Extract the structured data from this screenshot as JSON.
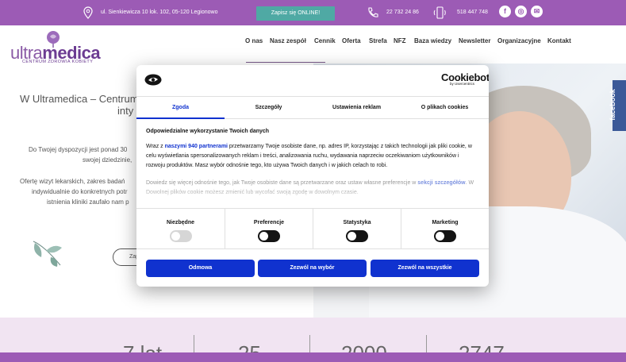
{
  "topbar": {
    "address": "ul. Sienkiewicza 10 lok. 102, 05-120 Legionowo",
    "online_button": "Zapisz się ONLINE!",
    "phone1": "22 732 24 86",
    "phone2": "518 447 748",
    "social": [
      "f",
      "◎",
      "✉"
    ]
  },
  "brand": {
    "logo_ultra": "ultra",
    "logo_medica": "medica",
    "logo_sub": "CENTRUM ZDROWIA KOBIETY"
  },
  "nav": [
    "O nas",
    "Nasz zespół",
    "Cennik",
    "Oferta",
    "Strefa",
    "NFZ",
    "Baza wiedzy",
    "Newsletter",
    "Organizacyjne",
    "Kontakt"
  ],
  "hero": {
    "title_line1": "W Ultramedica – Centrum",
    "title_line2": "inty",
    "p1_line1": "Do Twojej dyspozycji jest ponad 30",
    "p1_line2": "swojej dziedzinie,",
    "p2_line1": "Ofertę wizyt lekarskich, zakres badań",
    "p2_line2": "indywidualnie do konkretnych potr",
    "p2_line3": "istnienia kliniki zaufało nam p",
    "button": "Zap"
  },
  "facebook_tab": "facebook",
  "stats": [
    "7 lat",
    "25",
    "2000",
    "2747"
  ],
  "cookie_dialog": {
    "brand": "Cookiebot",
    "brand_sub": "by Usercentrics",
    "tabs": [
      "Zgoda",
      "Szczegóły",
      "Ustawienia reklam",
      "O plikach cookies"
    ],
    "active_tab": 0,
    "heading": "Odpowiedzialne wykorzystanie Twoich danych",
    "body_prefix": "Wraz z ",
    "partners_link": "naszymi 940 partnerami",
    "body_rest": " przetwarzamy Twoje osobiste dane, np. adres IP, korzystając z takich technologii jak pliki cookie, w celu wyświetlania spersonalizowanych reklam i treści, analizowania ruchu, wydawania naprzeciw oczekiwaniom użytkowników i rozwoju produktów. Masz wybór odnośnie tego, kto używa Twoich danych i w jakich celach to robi.",
    "faded_prefix": "Dowiedz się więcej odnośnie tego, jak Twoje osobiste dane są przetwarzane oraz ustaw własne preferencje w ",
    "faded_link": "sekcji szczegółów",
    "faded_rest": ". W Dowolnej plików cookie możesz zmienić lub wycofać swoją zgodę w dowolnym czasie.",
    "categories": [
      {
        "label": "Niezbędne",
        "enabled": false
      },
      {
        "label": "Preferencje",
        "enabled": true
      },
      {
        "label": "Statystyka",
        "enabled": true
      },
      {
        "label": "Marketing",
        "enabled": true
      }
    ],
    "buttons": [
      "Odmowa",
      "Zezwól na wybór",
      "Zezwól na wszystkie"
    ]
  },
  "colors": {
    "brand_purple": "#9c5bb5",
    "teal": "#4fa9a4",
    "cookie_blue": "#1032cf",
    "stats_bg": "#f1e4f2"
  }
}
